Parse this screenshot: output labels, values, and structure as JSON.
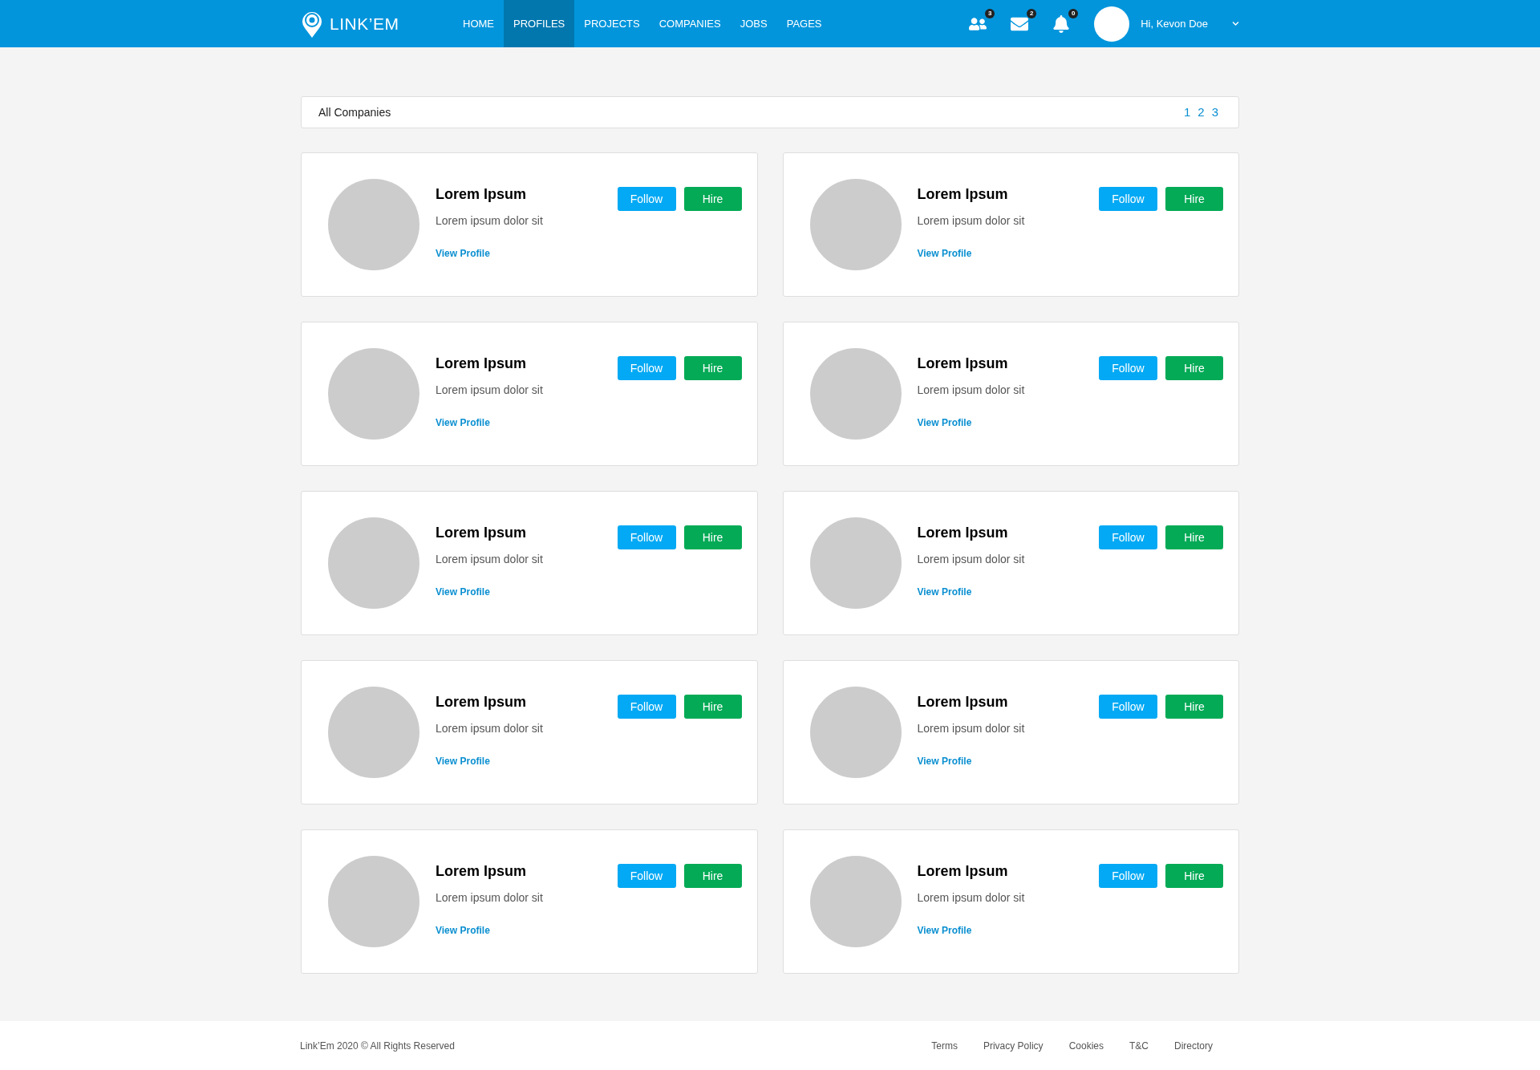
{
  "header": {
    "logo": "LINK’EM",
    "nav": [
      {
        "label": "HOME",
        "selected": false
      },
      {
        "label": "PROFILES",
        "selected": true
      },
      {
        "label": "PROJECTS",
        "selected": false
      },
      {
        "label": "COMPANIES",
        "selected": false
      },
      {
        "label": "JOBS",
        "selected": false
      },
      {
        "label": "PAGES",
        "selected": false
      }
    ],
    "notifications": [
      {
        "kind": "people",
        "count": "3"
      },
      {
        "kind": "mail",
        "count": "2"
      },
      {
        "kind": "bell",
        "count": "0"
      }
    ],
    "user": "Hi, Kevon Doe"
  },
  "panel": {
    "title": "All Companies",
    "pages": [
      "1",
      "2",
      "3"
    ]
  },
  "cards": [
    {
      "name": "Lorem Ipsum",
      "description": "Lorem ipsum dolor sit",
      "link": "View Profile",
      "follow": "Follow",
      "hire": "Hire"
    },
    {
      "name": "Lorem Ipsum",
      "description": "Lorem ipsum dolor sit",
      "link": "View Profile",
      "follow": "Follow",
      "hire": "Hire"
    },
    {
      "name": "Lorem Ipsum",
      "description": "Lorem ipsum dolor sit",
      "link": "View Profile",
      "follow": "Follow",
      "hire": "Hire"
    },
    {
      "name": "Lorem Ipsum",
      "description": "Lorem ipsum dolor sit",
      "link": "View Profile",
      "follow": "Follow",
      "hire": "Hire"
    },
    {
      "name": "Lorem Ipsum",
      "description": "Lorem ipsum dolor sit",
      "link": "View Profile",
      "follow": "Follow",
      "hire": "Hire"
    },
    {
      "name": "Lorem Ipsum",
      "description": "Lorem ipsum dolor sit",
      "link": "View Profile",
      "follow": "Follow",
      "hire": "Hire"
    },
    {
      "name": "Lorem Ipsum",
      "description": "Lorem ipsum dolor sit",
      "link": "View Profile",
      "follow": "Follow",
      "hire": "Hire"
    },
    {
      "name": "Lorem Ipsum",
      "description": "Lorem ipsum dolor sit",
      "link": "View Profile",
      "follow": "Follow",
      "hire": "Hire"
    },
    {
      "name": "Lorem Ipsum",
      "description": "Lorem ipsum dolor sit",
      "link": "View Profile",
      "follow": "Follow",
      "hire": "Hire"
    },
    {
      "name": "Lorem Ipsum",
      "description": "Lorem ipsum dolor sit",
      "link": "View Profile",
      "follow": "Follow",
      "hire": "Hire"
    }
  ],
  "footer": {
    "copyright": "Link’Em 2020 © All Rights Reserved",
    "links": [
      "Terms",
      "Privacy Policy",
      "Cookies",
      "T&C",
      "Directory"
    ]
  }
}
